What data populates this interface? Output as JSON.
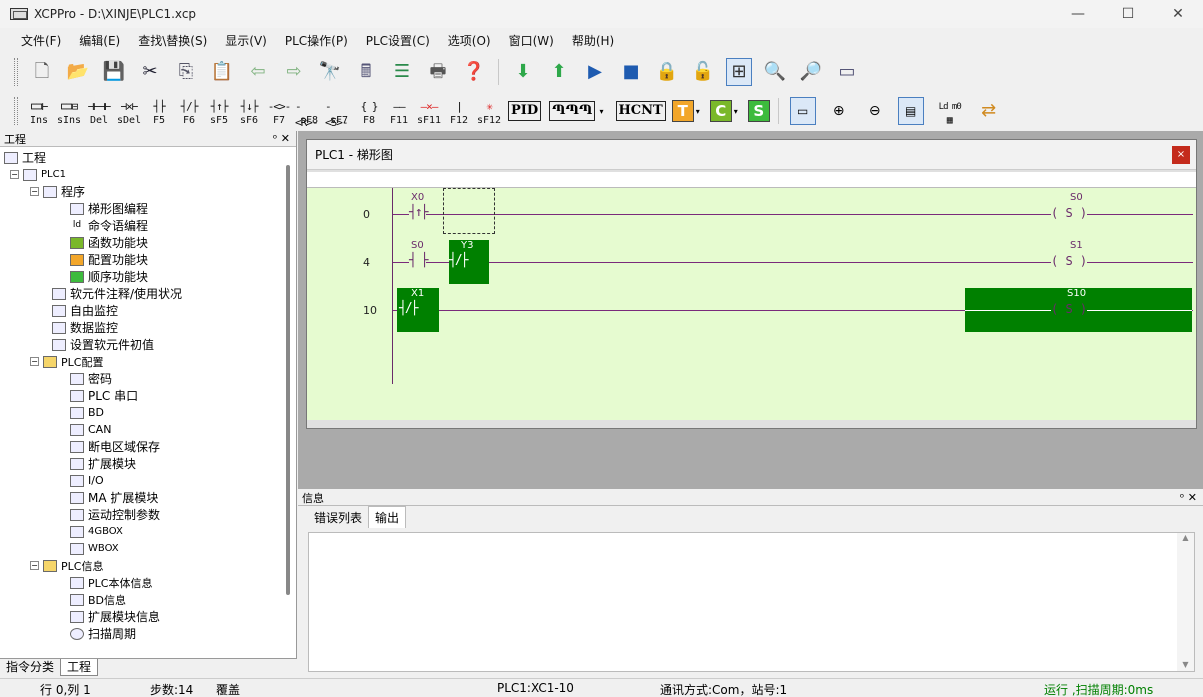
{
  "window": {
    "title": "XCPPro - D:\\XINJE\\PLC1.xcp",
    "minimize": "—",
    "maximize": "☐",
    "close": "✕"
  },
  "menu": [
    "文件(F)",
    "编辑(E)",
    "查找\\替换(S)",
    "显示(V)",
    "PLC操作(P)",
    "PLC设置(C)",
    "选项(O)",
    "窗口(W)",
    "帮助(H)"
  ],
  "toolbar2": {
    "labels": [
      "Ins",
      "sIns",
      "Del",
      "sDel",
      "F5",
      "F6",
      "sF5",
      "sF6",
      "F7",
      "sF8",
      "sF7",
      "F8",
      "F11",
      "sF11",
      "F12",
      "sF12"
    ],
    "symbols": [
      "⊏⊐⊢",
      "⊏⊐⊟",
      "⊣⊢⊣⊢",
      "⊣×⊢",
      "┤├",
      "┤/├",
      "┤↑├",
      "┤↓├",
      "-<>-",
      "-<R>-",
      "-<S>-",
      "{ }",
      "——",
      "—×—",
      "|",
      "✳"
    ],
    "pid": "PID",
    "hcnt": "HCNT",
    "t": "T",
    "c": "C",
    "s": "S",
    "ld": "Ld m0"
  },
  "left_panel": {
    "title": "工程",
    "pin": "ᵒ ✕",
    "tabs": [
      "指令分类",
      "工程"
    ],
    "tree": [
      {
        "label": "工程",
        "icon": "project"
      },
      {
        "label": "PLC1",
        "icon": "plc"
      },
      {
        "label": "程序",
        "icon": "program"
      },
      {
        "label": "梯形图编程",
        "icon": "ladder"
      },
      {
        "label": "命令语编程",
        "icon": "instr"
      },
      {
        "label": "函数功能块",
        "icon": "func"
      },
      {
        "label": "配置功能块",
        "icon": "cfg"
      },
      {
        "label": "顺序功能块",
        "icon": "seq"
      },
      {
        "label": "软元件注释/使用状况",
        "icon": "comment"
      },
      {
        "label": "自由监控",
        "icon": "monitor"
      },
      {
        "label": "数据监控",
        "icon": "datamon"
      },
      {
        "label": "设置软元件初值",
        "icon": "init"
      },
      {
        "label": "PLC配置",
        "icon": "folder"
      },
      {
        "label": "密码",
        "icon": "pwd"
      },
      {
        "label": "PLC 串口",
        "icon": "serial"
      },
      {
        "label": "BD",
        "icon": "bd"
      },
      {
        "label": "CAN",
        "icon": "can"
      },
      {
        "label": "断电区域保存",
        "icon": "power"
      },
      {
        "label": "扩展模块",
        "icon": "ext"
      },
      {
        "label": "I/O",
        "icon": "io"
      },
      {
        "label": "MA 扩展模块",
        "icon": "ma"
      },
      {
        "label": "运动控制参数",
        "icon": "motion"
      },
      {
        "label": "4GBOX",
        "icon": "4g"
      },
      {
        "label": "WBOX",
        "icon": "wbox"
      },
      {
        "label": "PLC信息",
        "icon": "folder"
      },
      {
        "label": "PLC本体信息",
        "icon": "plcinfo"
      },
      {
        "label": "BD信息",
        "icon": "bdinfo"
      },
      {
        "label": "扩展模块信息",
        "icon": "extinfo"
      },
      {
        "label": "扫描周期",
        "icon": "scan"
      }
    ]
  },
  "ladder": {
    "title": "PLC1 - 梯形图",
    "close": "×",
    "rungs": [
      {
        "step": "0",
        "contact1": "X0",
        "contact2": "",
        "coil": "S0",
        "coil_type": "S"
      },
      {
        "step": "4",
        "contact1": "S0",
        "contact2": "Y3",
        "coil": "S1",
        "coil_type": "S"
      },
      {
        "step": "10",
        "contact1": "X1",
        "contact2": "",
        "coil": "S10",
        "coil_type": "S"
      }
    ]
  },
  "info_panel": {
    "title": "信息",
    "pin": "ᵒ ✕",
    "tabs": [
      "错误列表",
      "输出"
    ]
  },
  "status": {
    "pos": "行 0,列 1",
    "steps": "步数:14",
    "mode": "覆盖",
    "plc": "PLC1:XC1-10",
    "comm": "通讯方式:Com，站号:1",
    "run": "运行 ,扫描周期:0ms"
  },
  "colors": {
    "accent": "#008000",
    "ladder_bg": "#e6fbd0",
    "wire": "#7a2a7a",
    "run_status": "#008000"
  }
}
